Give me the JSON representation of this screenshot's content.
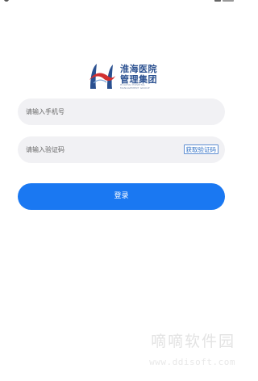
{
  "logo": {
    "name_line1": "淮海医院",
    "name_line2": "管理集团",
    "subtitle_line1": "HUAIHAI HOSPITAL",
    "subtitle_line2": "MANAGEMENT GROUP",
    "icon": "huaihai-logo-icon",
    "colors": {
      "primary": "#2a5090",
      "accent": "#d23030"
    }
  },
  "login_form": {
    "phone_placeholder": "请输入手机号",
    "phone_value": "",
    "code_placeholder": "请输入验证码",
    "code_value": "",
    "get_code_label": "获取验证码",
    "login_label": "登录"
  },
  "colors": {
    "primary_button": "#1a78f2",
    "input_background": "#f1f1f4",
    "link": "#2f6fc4"
  },
  "watermark": {
    "text": "嘀嘀软件园",
    "url": "www.ddisoft.com"
  }
}
